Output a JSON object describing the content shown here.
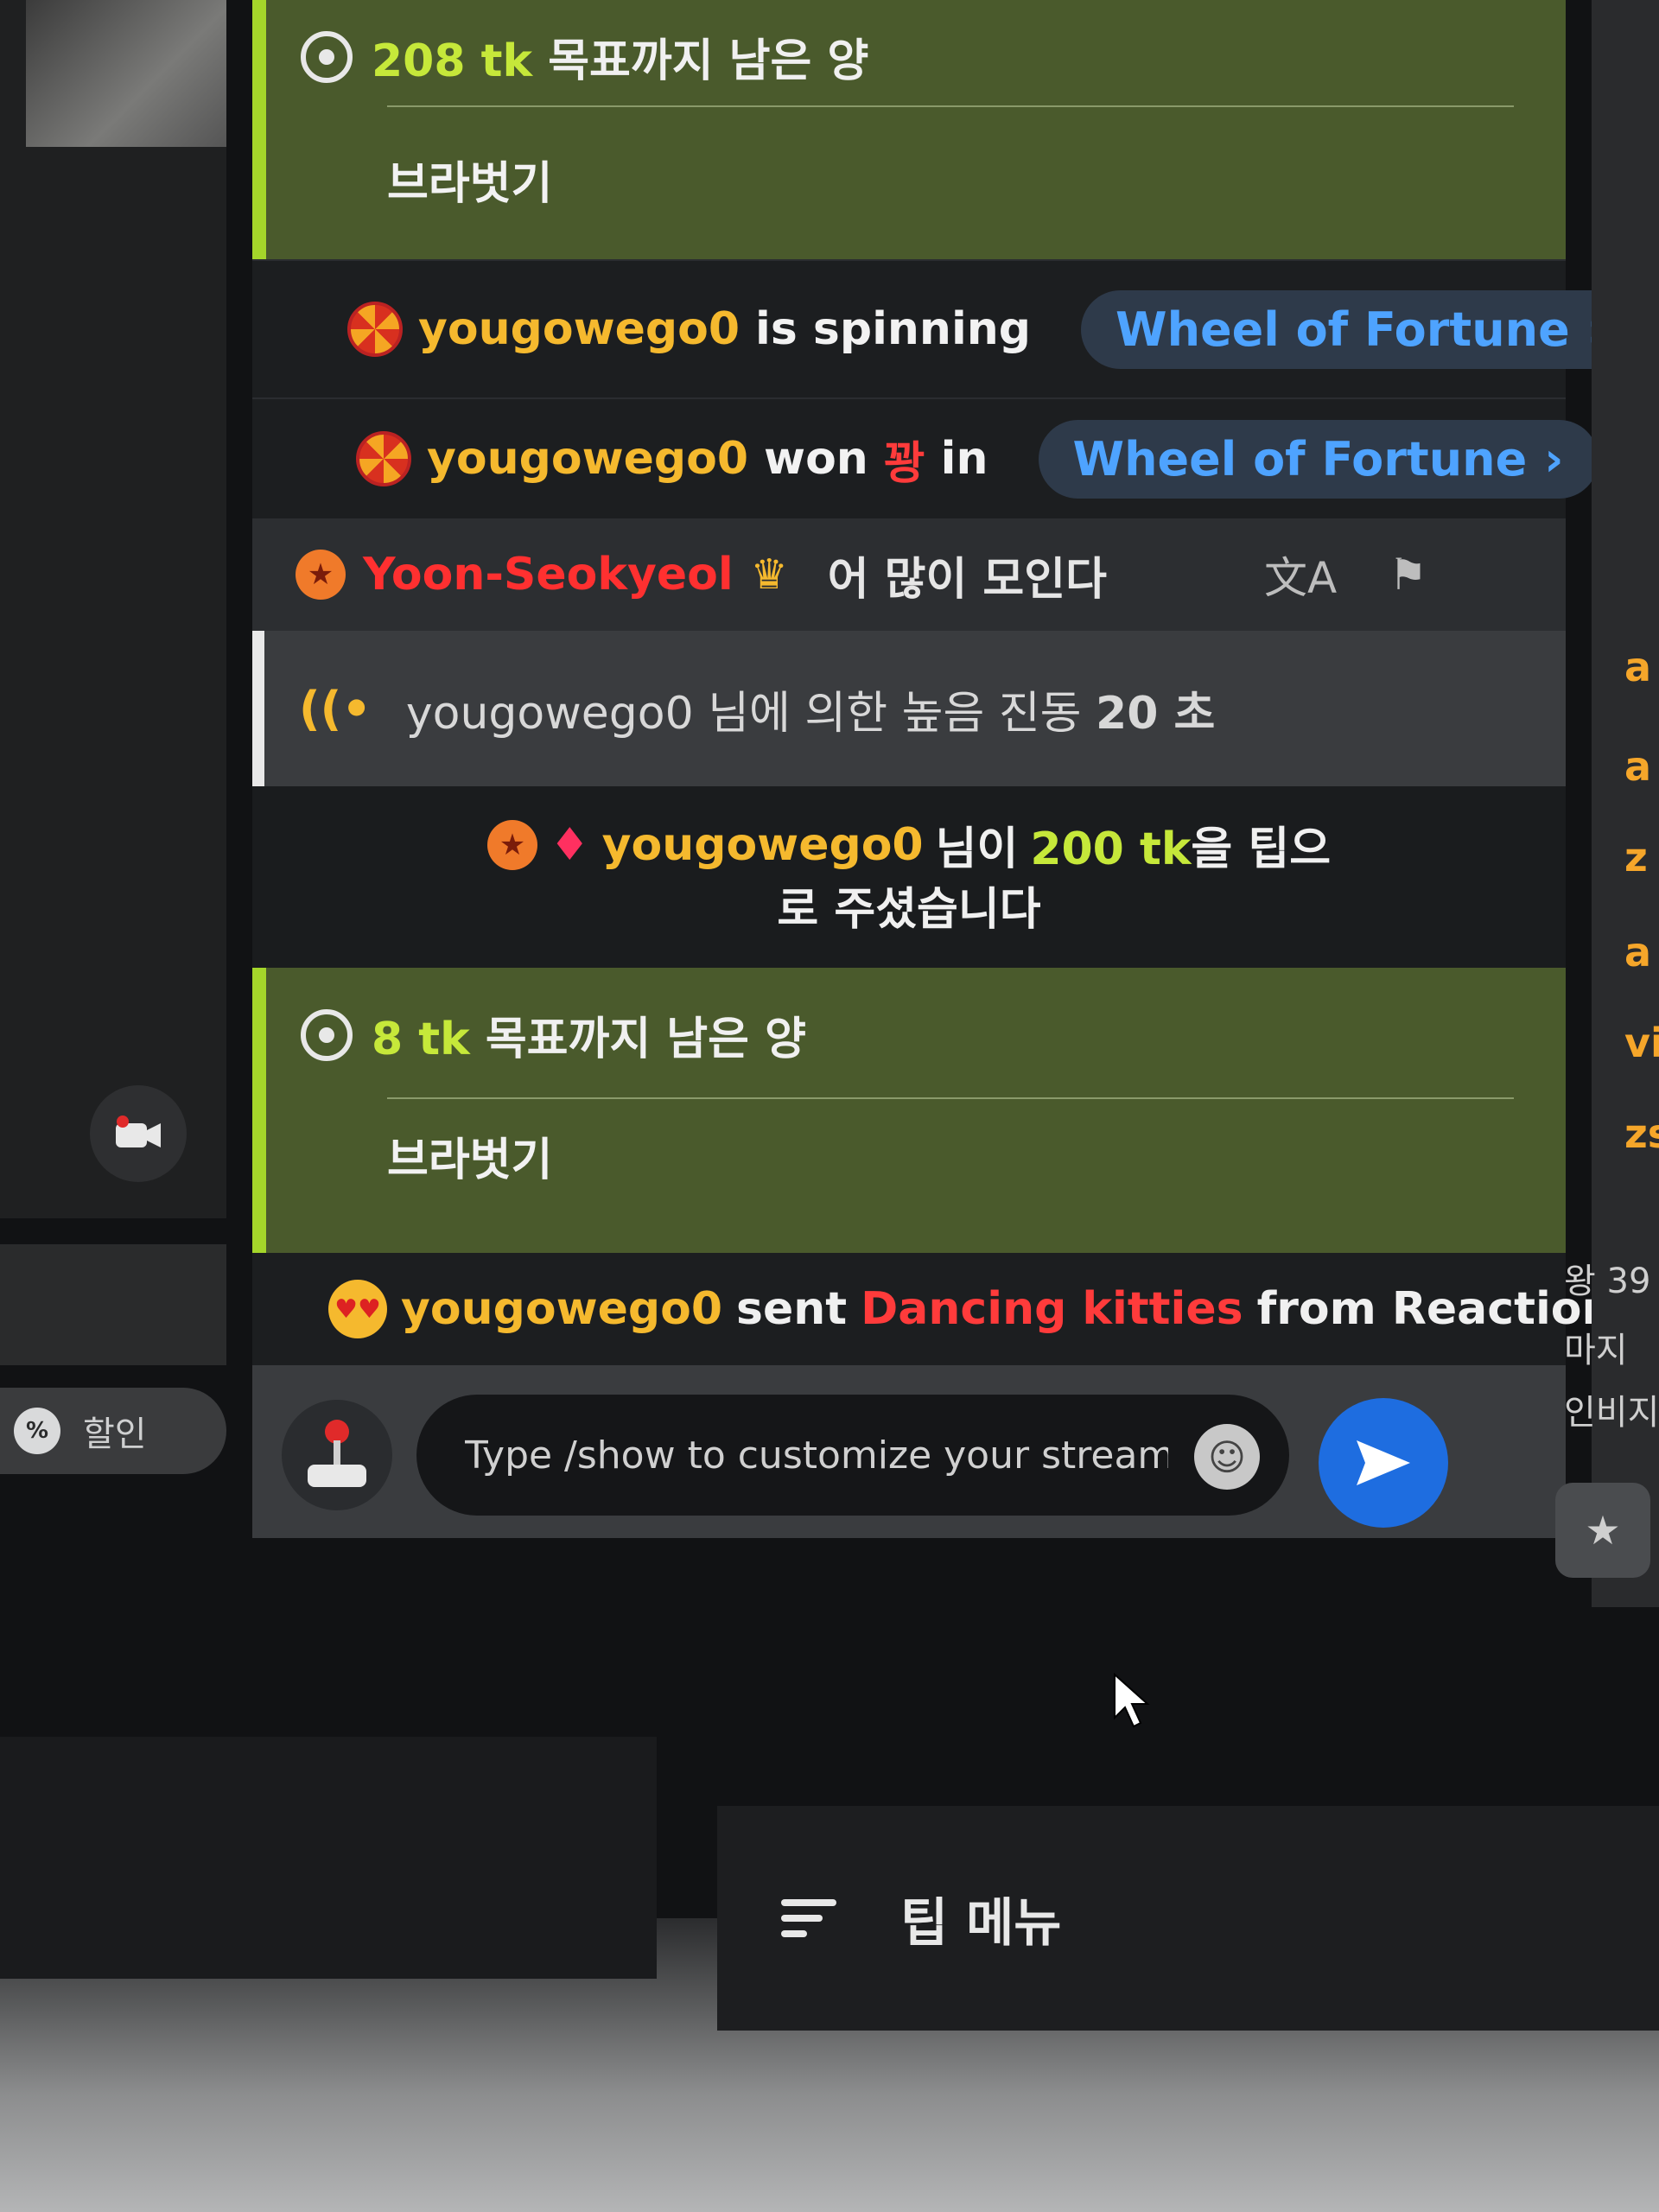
{
  "left_panel": {
    "discount_label": "할인",
    "discount_icon": "percent-icon",
    "camera_icon": "camera-icon"
  },
  "chat": {
    "goal_1": {
      "amount": "208 tk",
      "text": "목표까지 남은 양",
      "item": "브라벗기"
    },
    "spin_event": {
      "user": "yougowego0",
      "text": "is spinning",
      "link": "Wheel of Fortune"
    },
    "win_event": {
      "user": "yougowego0",
      "text_won": "won",
      "prize": "꽝",
      "text_in": "in",
      "link": "Wheel of Fortune"
    },
    "user_message": {
      "user": "Yoon-Seokyeol",
      "text": "어 많이 모인다",
      "translate_icon": "translate-icon",
      "report_icon": "flag-icon"
    },
    "vibe_event": {
      "user": "yougowego0",
      "text": "님에 의한 높음 진동",
      "duration": "20 초"
    },
    "tip_event": {
      "user": "yougowego0",
      "text_before": "님이",
      "amount": "200 tk",
      "text_after": "을 팁으",
      "line2": "로 주셨습니다"
    },
    "goal_2": {
      "amount": "8 tk",
      "text": "목표까지 남은 양",
      "item": "브라벗기"
    },
    "reaction_event": {
      "user": "yougowego0",
      "text_sent": "sent",
      "reaction": "Dancing kitties",
      "text_from": "from Reactions"
    },
    "composer": {
      "placeholder": "Type /show to customize your stream layo"
    }
  },
  "right_panel": {
    "items": [
      "a",
      "a",
      "z",
      "a",
      "vi",
      "zs"
    ],
    "texts": [
      "왕 39",
      "마지",
      "인비지"
    ]
  },
  "bottom": {
    "menu_label": "팁 메뉴"
  },
  "colors": {
    "goal_bg": "#4a5a2c",
    "goal_accent": "#a4d62a",
    "username": "#f5b92e",
    "link": "#4ea3ff",
    "send": "#1e6de0"
  }
}
